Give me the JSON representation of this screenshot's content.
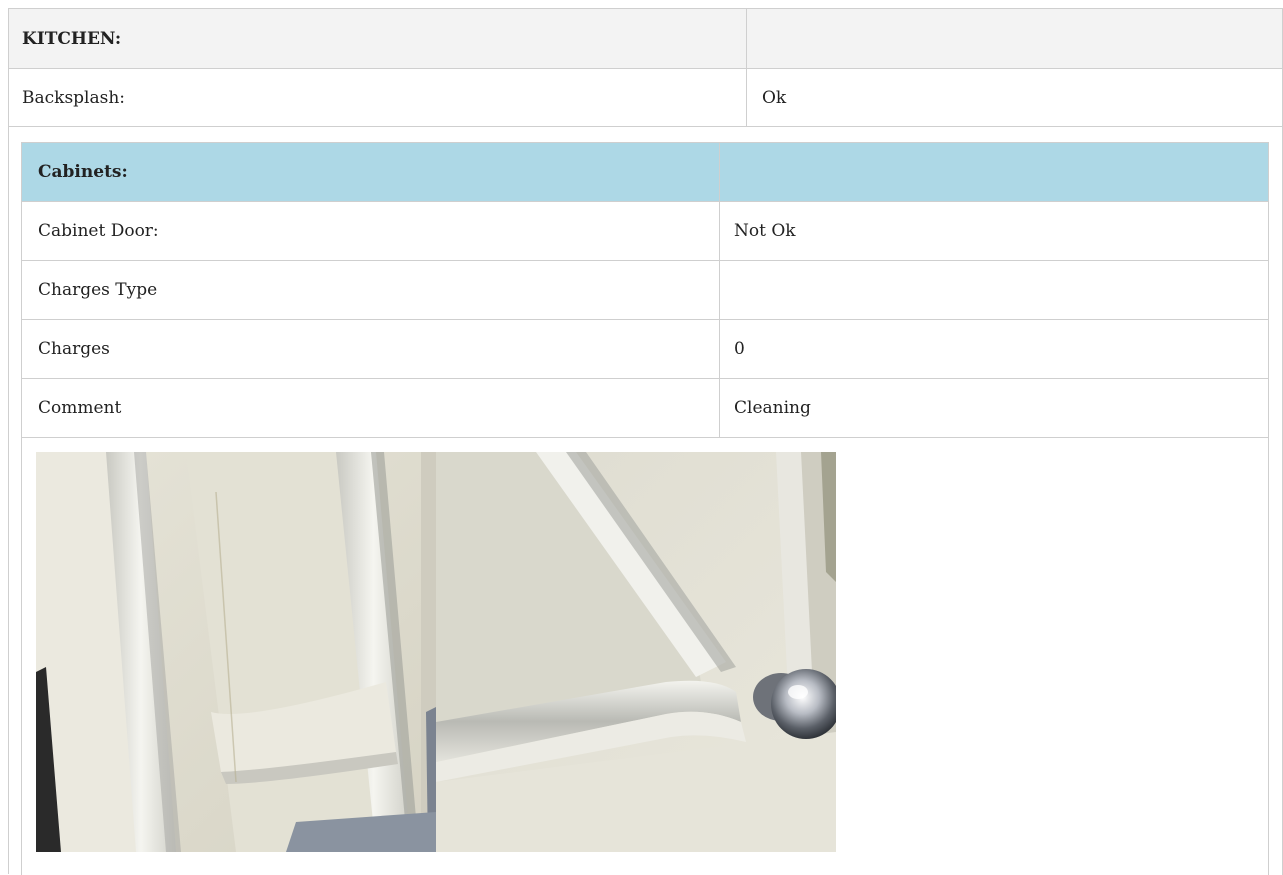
{
  "kitchen": {
    "title": "KITCHEN:",
    "title_value": "",
    "rows": [
      {
        "label": "Backsplash:",
        "value": "Ok"
      }
    ]
  },
  "cabinets": {
    "title": "Cabinets:",
    "title_value": "",
    "header_color": "#add8e6",
    "rows": [
      {
        "label": "Cabinet Door:",
        "value": "Not Ok"
      },
      {
        "label": "Charges Type",
        "value": ""
      },
      {
        "label": "Charges",
        "value": "0"
      },
      {
        "label": "Comment",
        "value": "Cleaning"
      }
    ]
  },
  "photos": [
    {
      "icon": "cabinet-door-photo"
    },
    {
      "icon": "cabinet-door-knob-photo"
    }
  ]
}
